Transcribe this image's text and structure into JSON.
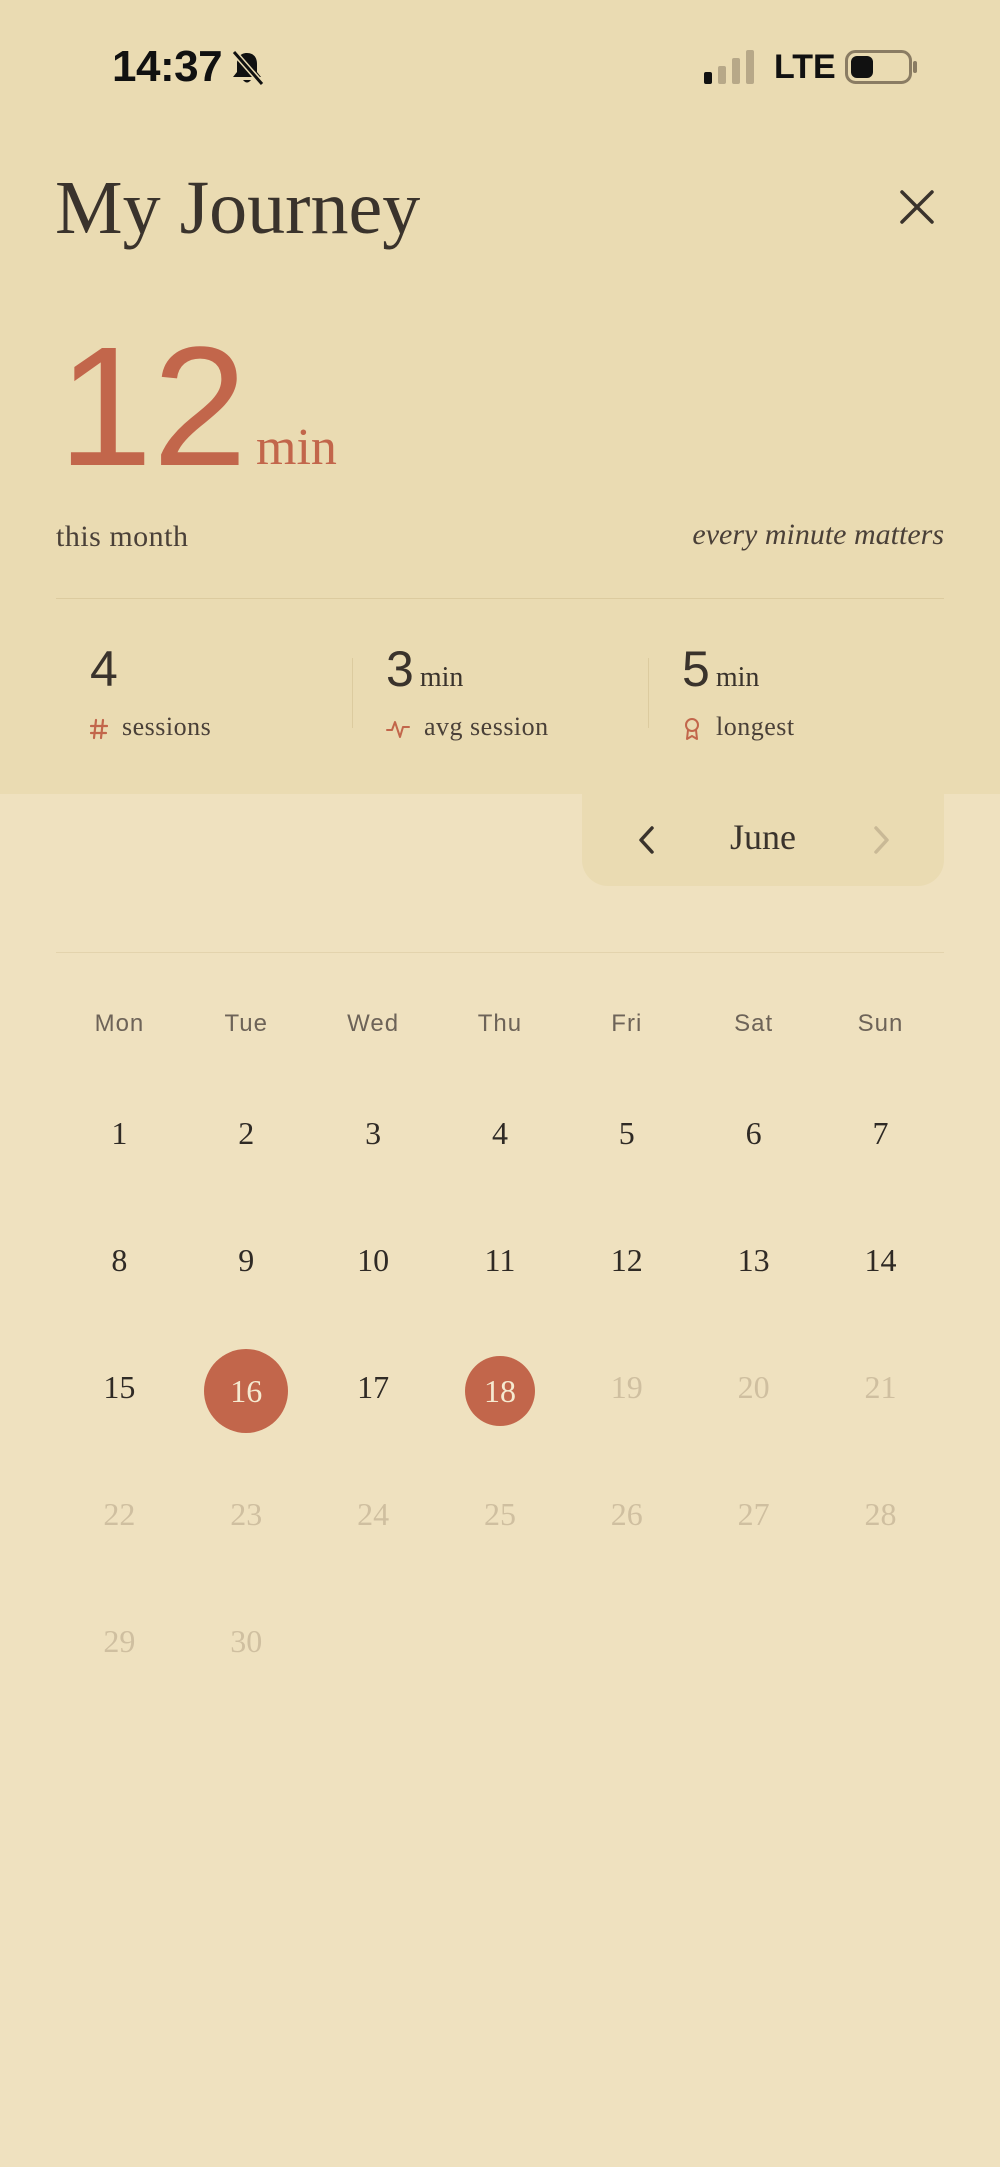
{
  "status": {
    "time": "14:37",
    "network": "LTE"
  },
  "header": {
    "title": "My Journey"
  },
  "summary": {
    "total_value": "12",
    "total_unit": "min",
    "period_label": "this month",
    "motto": "every minute matters"
  },
  "stats": [
    {
      "value": "4",
      "unit": "",
      "label": "sessions",
      "icon": "hash-icon"
    },
    {
      "value": "3",
      "unit": "min",
      "label": "avg session",
      "icon": "activity-icon"
    },
    {
      "value": "5",
      "unit": "min",
      "label": "longest",
      "icon": "award-icon"
    }
  ],
  "calendar": {
    "month": "June",
    "weekdays": [
      "Mon",
      "Tue",
      "Wed",
      "Thu",
      "Fri",
      "Sat",
      "Sun"
    ],
    "weeks": [
      [
        "1",
        "2",
        "3",
        "4",
        "5",
        "6",
        "7"
      ],
      [
        "8",
        "9",
        "10",
        "11",
        "12",
        "13",
        "14"
      ],
      [
        "15",
        "16",
        "17",
        "18",
        "19",
        "20",
        "21"
      ],
      [
        "22",
        "23",
        "24",
        "25",
        "26",
        "27",
        "28"
      ],
      [
        "29",
        "30",
        "",
        "",
        "",
        "",
        ""
      ]
    ],
    "active_days": [
      "16",
      "18"
    ],
    "last_available_day": 18
  },
  "colors": {
    "accent": "#c2664b",
    "panel": "#eadbb2",
    "background": "#efe1bf",
    "text": "#3a332c",
    "muted": "#cfbfa0"
  }
}
